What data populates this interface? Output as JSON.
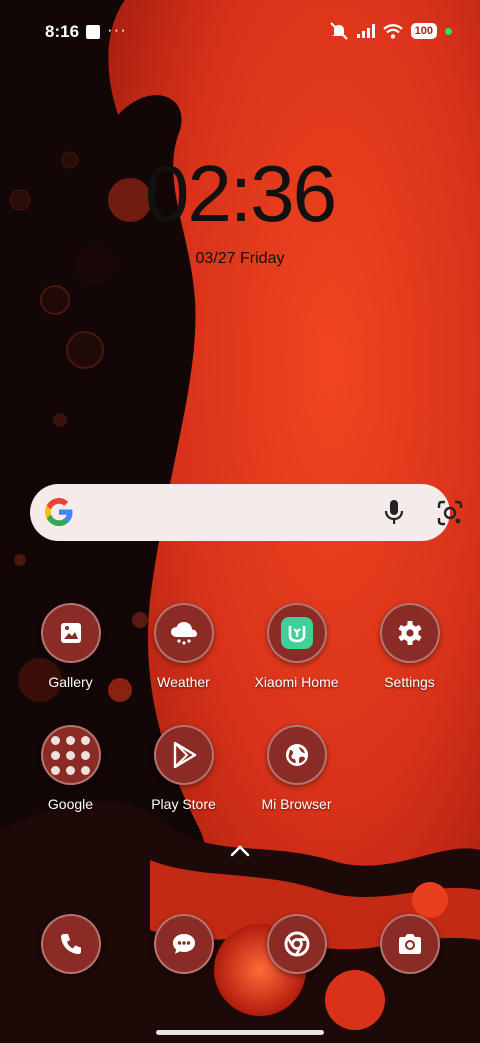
{
  "status_bar": {
    "time": "8:16",
    "overflow": "···",
    "battery": "100",
    "icons": [
      "silent-icon",
      "signal-icon",
      "wifi-icon"
    ]
  },
  "clock": {
    "time": "02:36",
    "date": "03/27 Friday"
  },
  "search": {
    "value": "",
    "placeholder": ""
  },
  "apps": {
    "row1": [
      {
        "label": "Gallery",
        "icon": "gallery-icon"
      },
      {
        "label": "Weather",
        "icon": "weather-icon"
      },
      {
        "label": "Xiaomi Home",
        "icon": "xiaomi-home-icon"
      },
      {
        "label": "Settings",
        "icon": "gear-icon"
      }
    ],
    "row2": [
      {
        "label": "Google",
        "icon": "folder-icon"
      },
      {
        "label": "Play Store",
        "icon": "play-store-icon"
      },
      {
        "label": "Mi Browser",
        "icon": "globe-icon"
      }
    ],
    "dock": [
      {
        "icon": "phone-icon"
      },
      {
        "icon": "messages-icon"
      },
      {
        "icon": "chrome-icon"
      },
      {
        "icon": "camera-icon"
      }
    ]
  },
  "colors": {
    "icon_bg": "#8a2b25",
    "wallpaper_red": "#e23a1c",
    "wallpaper_dark": "#150707"
  }
}
